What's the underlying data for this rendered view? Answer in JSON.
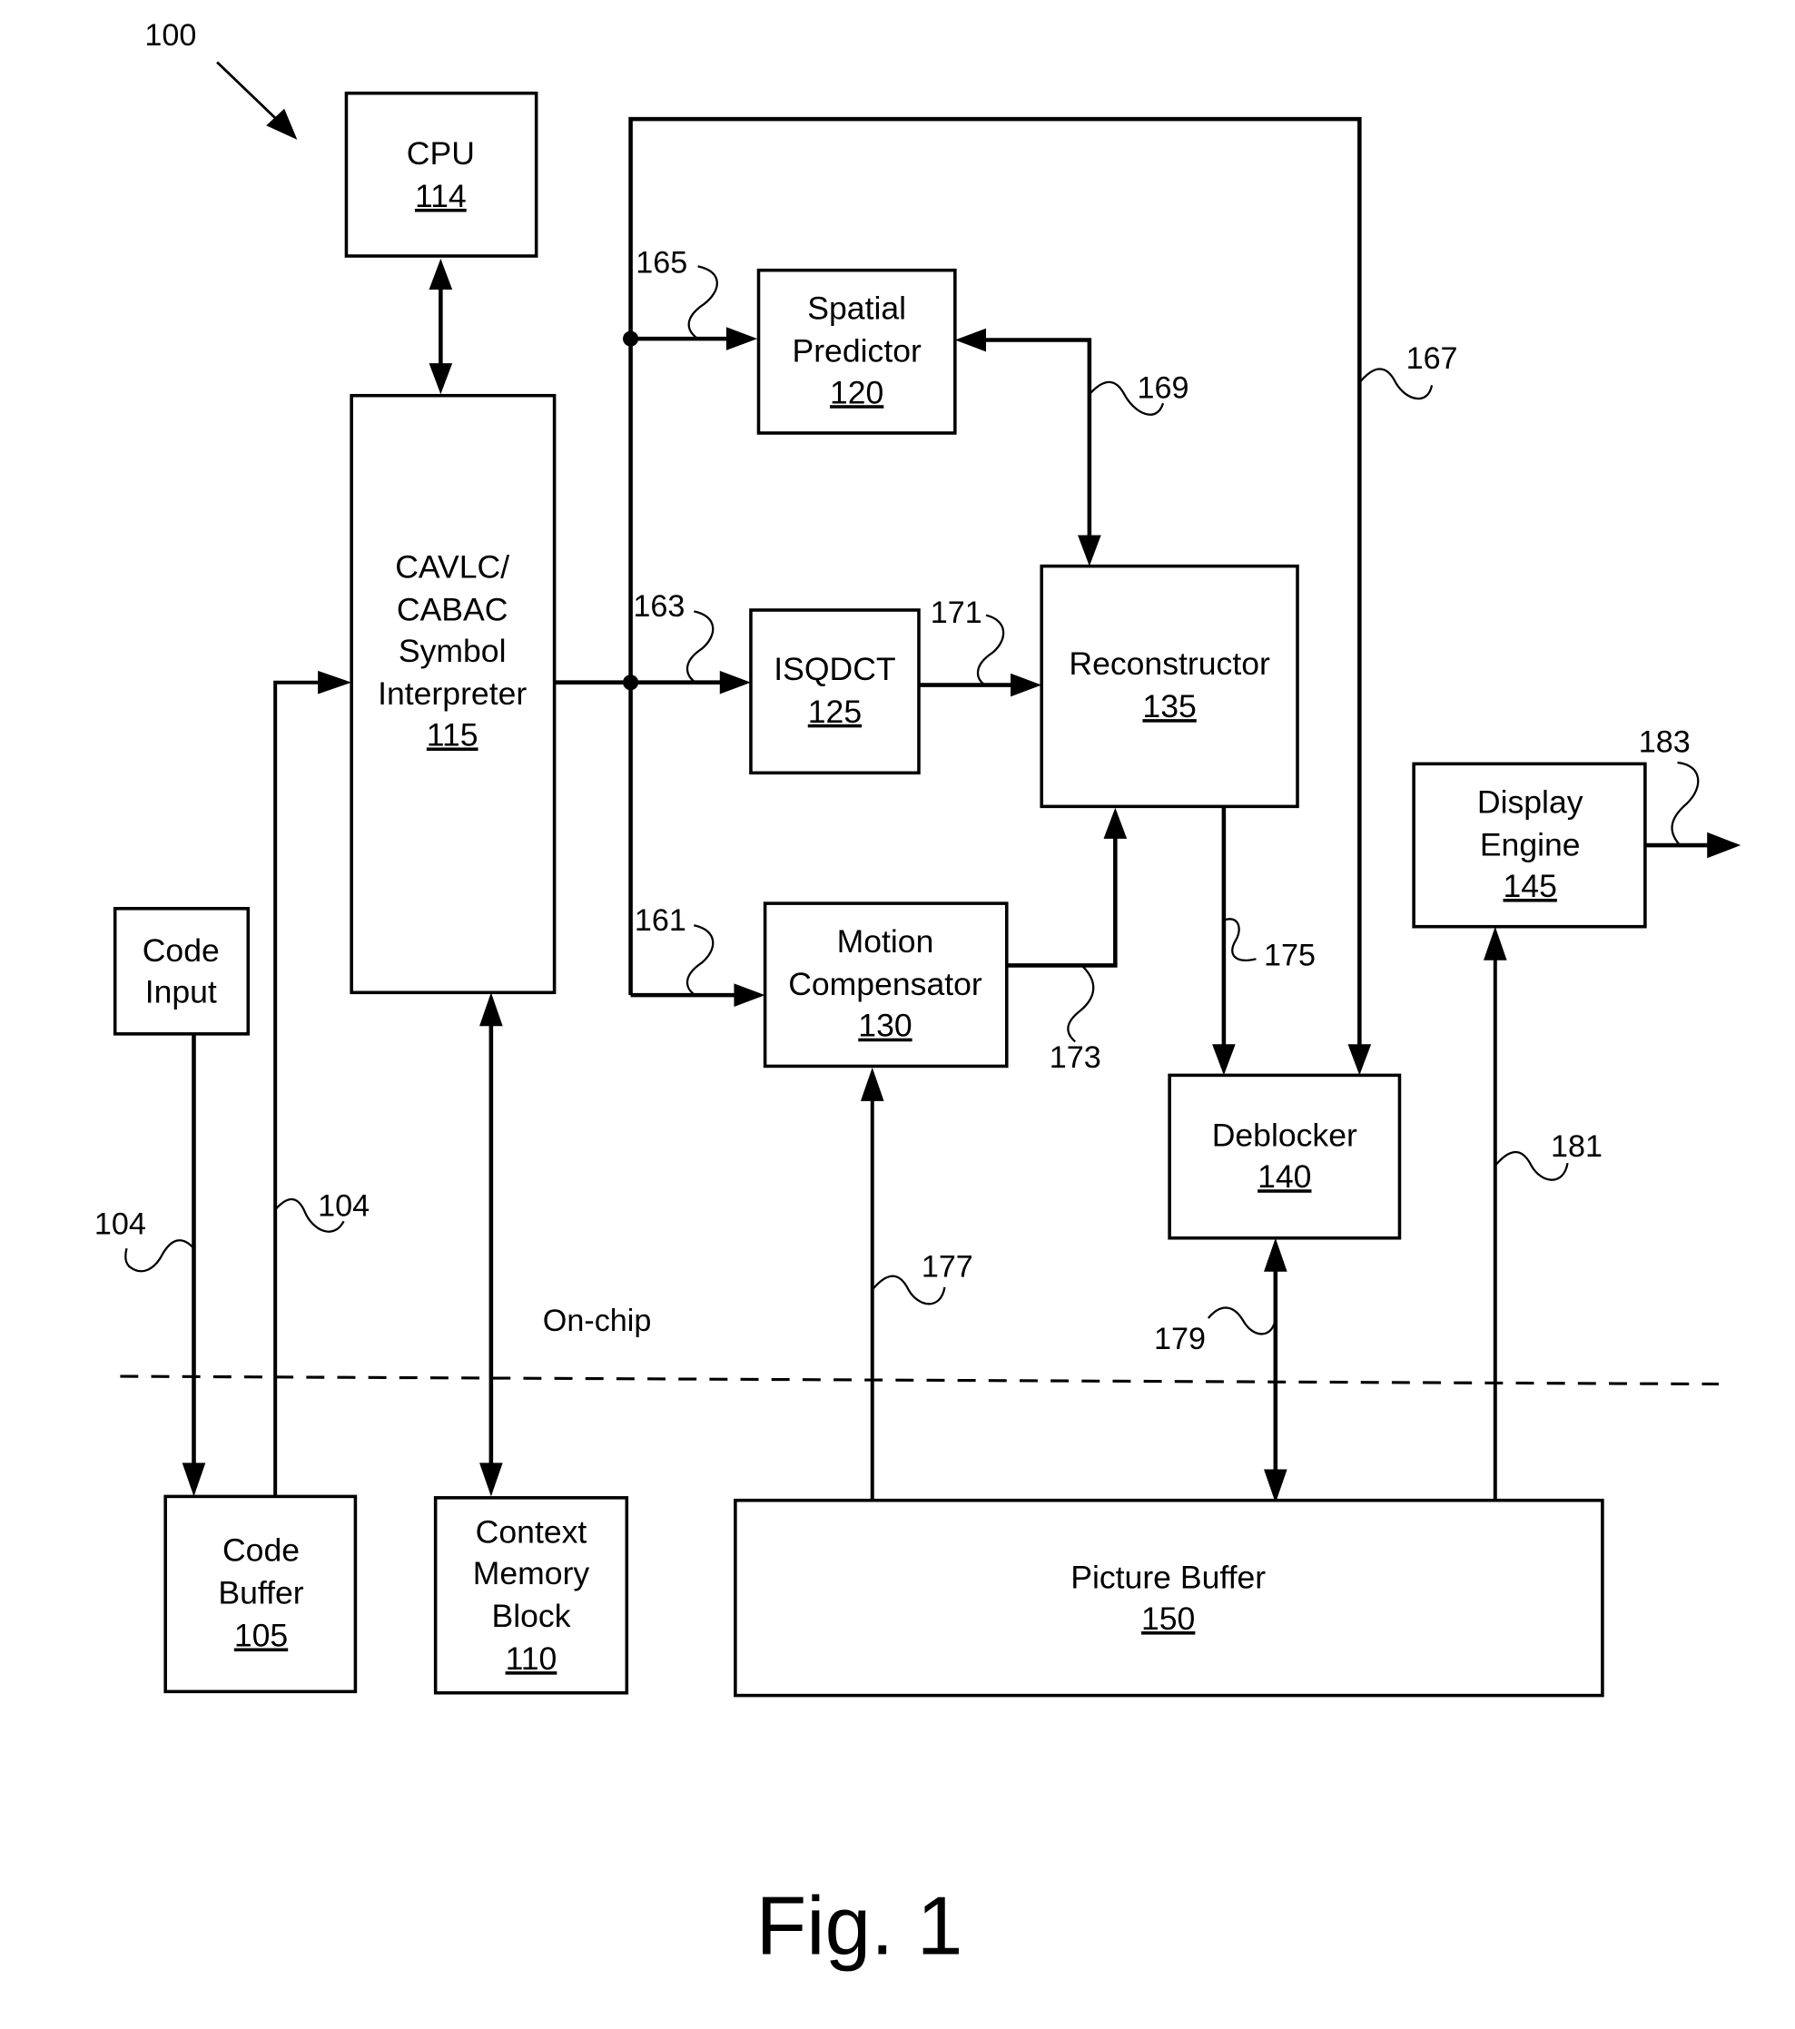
{
  "figure": {
    "caption": "Fig. 1",
    "system_ref": "100",
    "region_label": "On-chip"
  },
  "blocks": {
    "cpu": {
      "lines": [
        "CPU"
      ],
      "ref": "114"
    },
    "symbol_interpreter": {
      "lines": [
        "CAVLC/",
        "CABAC",
        "Symbol",
        "Interpreter"
      ],
      "ref": "115"
    },
    "spatial_predictor": {
      "lines": [
        "Spatial",
        "Predictor"
      ],
      "ref": "120"
    },
    "isqdct": {
      "lines": [
        "ISQDCT"
      ],
      "ref": "125"
    },
    "reconstructor": {
      "lines": [
        "Reconstructor"
      ],
      "ref": "135"
    },
    "motion_compensator": {
      "lines": [
        "Motion",
        "Compensator"
      ],
      "ref": "130"
    },
    "display_engine": {
      "lines": [
        "Display",
        "Engine"
      ],
      "ref": "145"
    },
    "deblocker": {
      "lines": [
        "Deblocker"
      ],
      "ref": "140"
    },
    "code_input": {
      "lines": [
        "Code",
        "Input"
      ]
    },
    "code_buffer": {
      "lines": [
        "Code",
        "Buffer"
      ],
      "ref": "105"
    },
    "context_memory": {
      "lines": [
        "Context",
        "Memory",
        "Block"
      ],
      "ref": "110"
    },
    "picture_buffer": {
      "lines": [
        "Picture Buffer"
      ],
      "ref": "150"
    }
  },
  "connection_refs": {
    "input_to_code_buffer": "104",
    "code_buffer_to_interpreter": "104",
    "to_motion_compensator": "161",
    "to_isqdct": "163",
    "to_spatial_predictor": "165",
    "to_deblocker": "167",
    "spatial_reconstructor": "169",
    "isqdct_to_reconstructor": "171",
    "mc_to_reconstructor": "173",
    "reconstructor_to_deblocker": "175",
    "picture_buffer_to_mc": "177",
    "deblocker_picture_buffer": "179",
    "picture_buffer_to_display": "181",
    "display_output": "183"
  }
}
